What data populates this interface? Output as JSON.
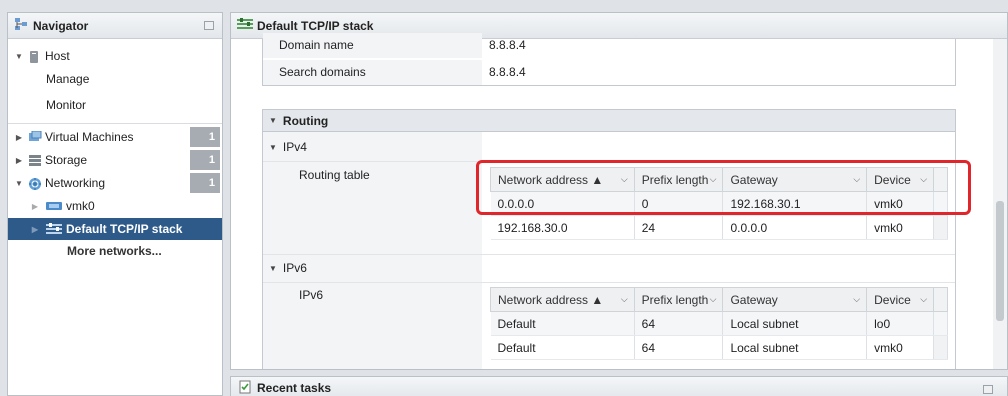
{
  "navigator": {
    "title": "Navigator",
    "host": "Host",
    "manage": "Manage",
    "monitor": "Monitor",
    "virtual_machines": "Virtual Machines",
    "virtual_machines_count": "1",
    "storage": "Storage",
    "storage_count": "1",
    "networking": "Networking",
    "networking_count": "1",
    "vmk0": "vmk0",
    "default_stack": "Default TCP/IP stack",
    "more_networks": "More networks..."
  },
  "main": {
    "title": "Default TCP/IP stack",
    "domain_name_label": "Domain name",
    "domain_name_value": "8.8.8.4",
    "search_domains_label": "Search domains",
    "search_domains_value": "8.8.8.4",
    "routing_title": "Routing",
    "ipv4_label": "IPv4",
    "routing_table_label": "Routing table",
    "ipv6_label": "IPv6",
    "ipv6_sub_label": "IPv6",
    "columns": {
      "network_address": "Network address ▲",
      "prefix_length": "Prefix length",
      "gateway": "Gateway",
      "device": "Device"
    },
    "ipv4_rows": [
      {
        "network": "0.0.0.0",
        "prefix": "0",
        "gateway": "192.168.30.1",
        "device": "vmk0"
      },
      {
        "network": "192.168.30.0",
        "prefix": "24",
        "gateway": "0.0.0.0",
        "device": "vmk0"
      }
    ],
    "ipv6_rows": [
      {
        "network": "Default",
        "prefix": "64",
        "gateway": "Local subnet",
        "device": "lo0"
      },
      {
        "network": "Default",
        "prefix": "64",
        "gateway": "Local subnet",
        "device": "vmk0"
      }
    ]
  },
  "tasks": {
    "title": "Recent tasks"
  },
  "colors": {
    "selected": "#2e5a8a",
    "highlight": "#e0262b",
    "badge": "#a6acb2"
  }
}
